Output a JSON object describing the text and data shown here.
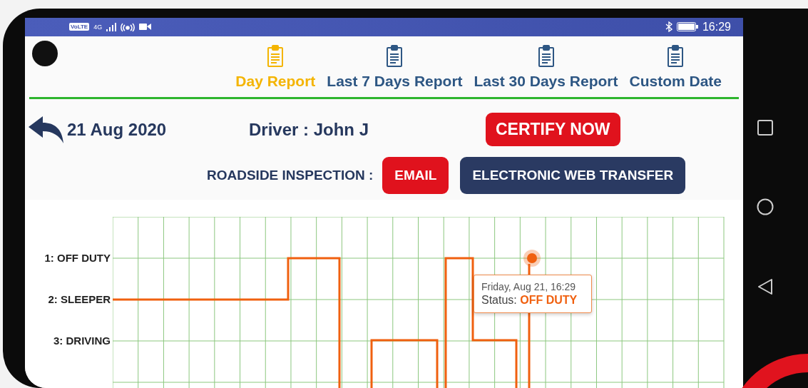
{
  "status_bar": {
    "volte": "VoLTE",
    "network": "4G",
    "time": "16:29"
  },
  "tabs": [
    {
      "label": "Day Report",
      "selected": true
    },
    {
      "label": "Last 7 Days Report",
      "selected": false
    },
    {
      "label": "Last 30 Days Report",
      "selected": false
    },
    {
      "label": "Custom Date",
      "selected": false
    }
  ],
  "log": {
    "date": "21 Aug 2020",
    "driver": "Driver : John J",
    "certify_button": "CERTIFY NOW"
  },
  "roadside": {
    "label": "ROADSIDE INSPECTION :",
    "buttons": [
      {
        "label": "EMAIL",
        "kind": "danger"
      },
      {
        "label": "ELECTRONIC WEB TRANSFER",
        "kind": "primary"
      }
    ]
  },
  "chart": {
    "rows": [
      "1: OFF DUTY",
      "2: SLEEPER",
      "3: DRIVING"
    ],
    "tooltip": {
      "time": "Friday, Aug 21, 16:29",
      "status": "Status: **OFF DUTY**"
    }
  }
}
